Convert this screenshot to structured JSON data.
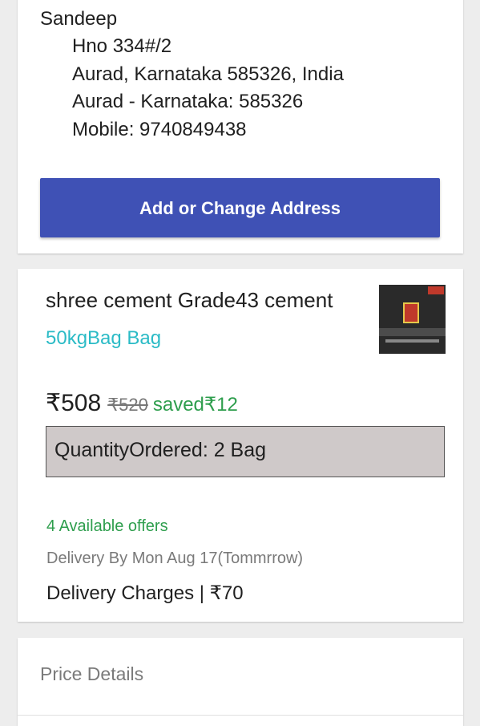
{
  "address": {
    "name": "Sandeep",
    "lines": [
      "Hno 334#/2",
      "Aurad, Karnataka 585326, India",
      "Aurad - Karnataka: 585326",
      "Mobile: 9740849438"
    ],
    "button_label": "Add or Change Address",
    "button_color": "#3f51b5"
  },
  "product": {
    "title": "shree cement Grade43 cement",
    "variant": "50kgBag Bag",
    "thumbnail_icon": "cement-bag-image",
    "price": "₹508",
    "mrp": "₹520",
    "saved": "saved₹12",
    "quantity": "QuantityOrdered: 2 Bag",
    "offers": "4 Available offers",
    "delivery_date": "Delivery By Mon Aug 17(Tommrrow)",
    "delivery_charges": "Delivery Charges | ₹70"
  },
  "price_details": {
    "title": "Price Details"
  }
}
